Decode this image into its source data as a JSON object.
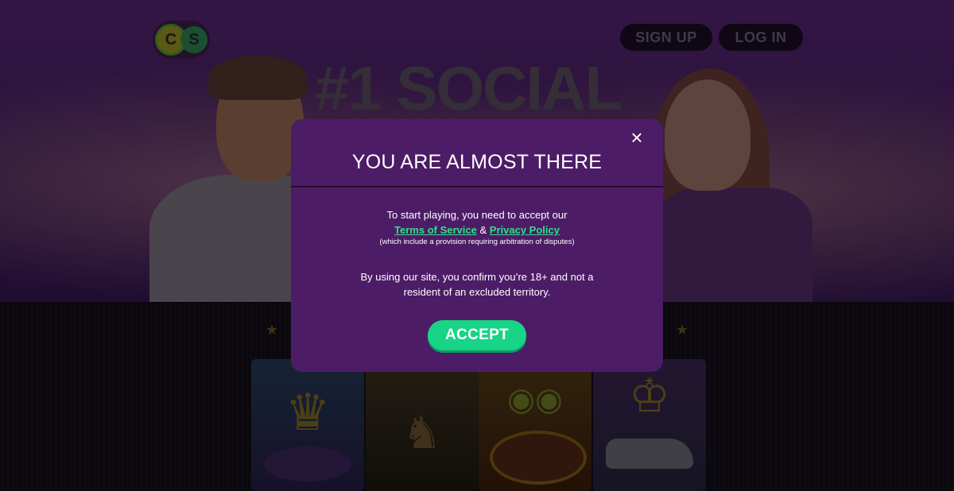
{
  "header": {
    "logo_letters": [
      "C",
      "S"
    ],
    "signup_label": "SIGN UP",
    "login_label": "LOG IN"
  },
  "hero": {
    "headline": "#1 SOCIAL"
  },
  "modal": {
    "title": "YOU ARE ALMOST THERE",
    "close_icon": "×",
    "line1": "To start playing, you need to accept our",
    "terms_label": "Terms of Service",
    "ampersand": "&",
    "privacy_label": "Privacy Policy",
    "note": "(which include a provision requiring arbitration of disputes)",
    "confirm": "By using our site, you confirm you’re 18+ and not a resident of an excluded territory.",
    "accept_label": "ACCEPT"
  },
  "colors": {
    "modal_bg": "#4d1c66",
    "link": "#2fe08a",
    "accept_bg": "#18d487"
  }
}
